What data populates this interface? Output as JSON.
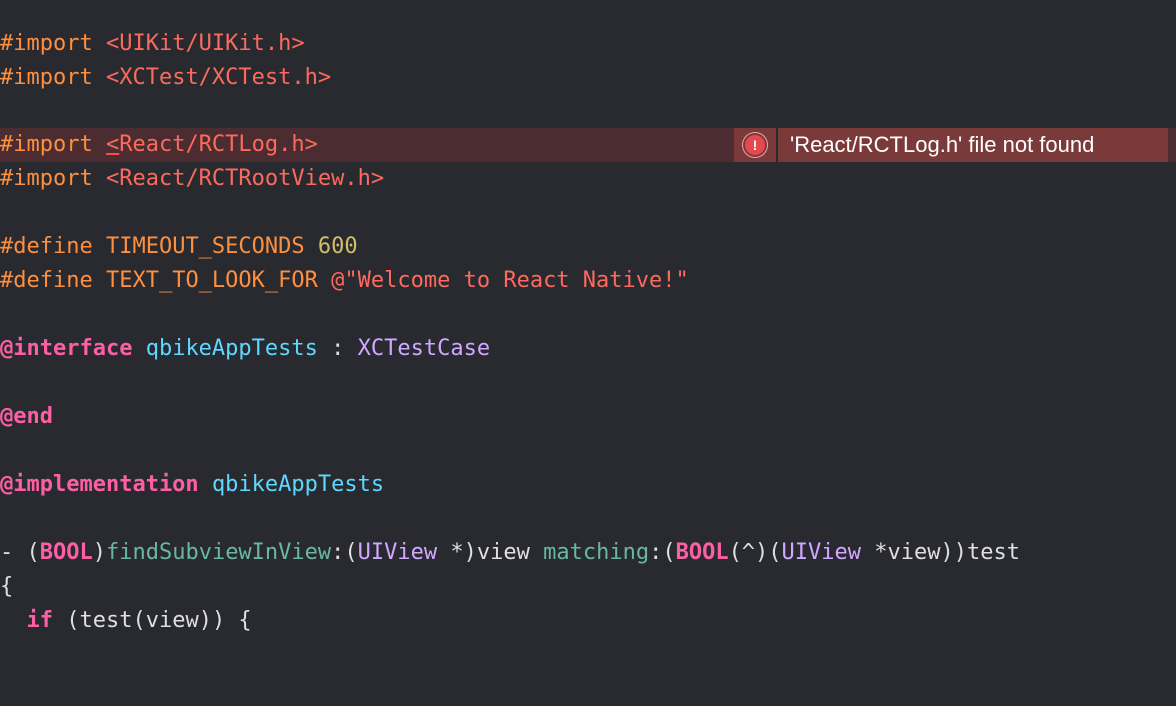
{
  "editor": {
    "language": "objective-c",
    "error": {
      "icon": "error-circle-icon",
      "glyph": "!",
      "message": "'React/RCTLog.h' file not found"
    },
    "lines": {
      "l1": {
        "kw": "#import",
        "path": "<UIKit/UIKit.h>"
      },
      "l2": {
        "kw": "#import",
        "path": "<XCTest/XCTest.h>"
      },
      "l4": {
        "kw": "#import",
        "mark": "<",
        "path": "React/RCTLog.h>"
      },
      "l5": {
        "kw": "#import",
        "path": "<React/RCTRootView.h>"
      },
      "l7": {
        "kw": "#define",
        "name": "TIMEOUT_SECONDS",
        "value": "600"
      },
      "l8": {
        "kw": "#define",
        "name": "TEXT_TO_LOOK_FOR",
        "value": "@\"Welcome to React Native!\""
      },
      "l10": {
        "kw": "@interface",
        "cls": "qbikeAppTests",
        "sep": " : ",
        "super": "XCTestCase"
      },
      "l12": {
        "kw": "@end"
      },
      "l14": {
        "kw": "@implementation",
        "cls": "qbikeAppTests"
      },
      "l16": {
        "dash": "- (",
        "ret": "BOOL",
        "p1": ")",
        "sel1": "findSubviewInView",
        "p2": ":(",
        "t1": "UIView",
        "p3": " *)view ",
        "sel2": "matching",
        "p4": ":(",
        "ret2": "BOOL",
        "p5": "(^)(",
        "t2": "UIView",
        "p6": " *view))test"
      },
      "l17": {
        "text": "{"
      },
      "l18": {
        "indent": "  ",
        "kw": "if",
        "rest": " (test(view)) {"
      }
    },
    "colors": {
      "background": "#292a30",
      "preprocessor": "#fd8f3f",
      "string": "#fc6a5d",
      "number": "#d0bf69",
      "keyword": "#fc5fa3",
      "type": "#5dd8ff",
      "class": "#d0a8ff",
      "method": "#67b7a4",
      "error_bg": "#7b3a3a"
    }
  }
}
